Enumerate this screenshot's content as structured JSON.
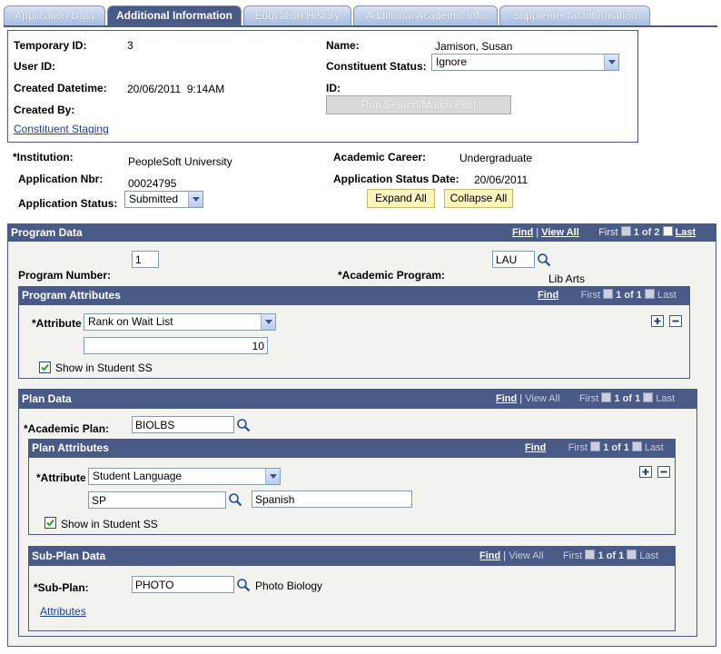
{
  "tabs": [
    {
      "label": "Application Data",
      "active": false
    },
    {
      "label": "Additional Information",
      "active": true
    },
    {
      "label": "Education History",
      "active": false
    },
    {
      "label": "Additional Academic Info",
      "active": false
    },
    {
      "label": "Supplemental Information",
      "active": false
    }
  ],
  "staging": {
    "temporary_id_label": "Temporary ID:",
    "temporary_id": "3",
    "user_id_label": "User ID:",
    "created_datetime_label": "Created Datetime:",
    "created_datetime": "20/06/2011  9:14AM",
    "created_by_label": "Created By:",
    "constituent_staging_link": "Constituent Staging",
    "name_label": "Name:",
    "name": "Jamison, Susan",
    "constituent_status_label": "Constituent Status:",
    "constituent_status": "Ignore",
    "id_label": "ID:",
    "run_button": "Run Search/Match/Post"
  },
  "application": {
    "institution_label": "*Institution:",
    "institution": "PeopleSoft University",
    "application_nbr_label": "Application Nbr:",
    "application_nbr": "00024795",
    "application_status_label": "Application Status:",
    "application_status": "Submitted",
    "academic_career_label": "Academic Career:",
    "academic_career": "Undergraduate",
    "application_status_date_label": "Application Status Date:",
    "application_status_date": "20/06/2011",
    "expand_all": "Expand All",
    "collapse_all": "Collapse All"
  },
  "program": {
    "title": "Program Data",
    "find": "Find",
    "sep": "|",
    "view_all": "View All",
    "first": "First",
    "count": "1 of 2",
    "last": "Last",
    "program_number_label": "Program Number:",
    "program_number": "1",
    "academic_program_label": "*Academic Program:",
    "academic_program": "LAU",
    "academic_program_desc": "Lib Arts"
  },
  "program_attributes": {
    "title": "Program Attributes",
    "find": "Find",
    "first": "First",
    "count": "1 of 1",
    "last": "Last",
    "attribute_label": "*Attribute",
    "attribute": "Rank on Wait List",
    "attribute_value": "10",
    "show_in_ss_label": "Show in Student SS",
    "show_in_ss": true
  },
  "plan": {
    "title": "Plan Data",
    "find": "Find",
    "sep": "|",
    "view_all": "View All",
    "first": "First",
    "count": "1 of 1",
    "last": "Last",
    "academic_plan_label": "*Academic Plan:",
    "academic_plan": "BIOLBS"
  },
  "plan_attributes": {
    "title": "Plan Attributes",
    "find": "Find",
    "first": "First",
    "count": "1 of 1",
    "last": "Last",
    "attribute_label": "*Attribute",
    "attribute": "Student Language",
    "attribute_value": "SP",
    "attribute_desc": "Spanish",
    "show_in_ss_label": "Show in Student SS",
    "show_in_ss": true
  },
  "subplan": {
    "title": "Sub-Plan Data",
    "find": "Find",
    "sep": "|",
    "view_all": "View All",
    "first": "First",
    "count": "1 of 1",
    "last": "Last",
    "subplan_label": "*Sub-Plan:",
    "subplan": "PHOTO",
    "subplan_desc": "Photo Biology",
    "attributes_link": "Attributes"
  },
  "icons": {
    "add": "plus-icon",
    "delete": "minus-icon",
    "lookup": "magnifier-icon",
    "prev": "arrow-left-icon",
    "next": "arrow-right-icon",
    "check": "checkmark-icon"
  },
  "colors": {
    "header_bg": "#4a5a86",
    "link": "#1a3fa6",
    "button_yellow": "#fbf4bf",
    "panel_bg": "#f2f3ee"
  }
}
